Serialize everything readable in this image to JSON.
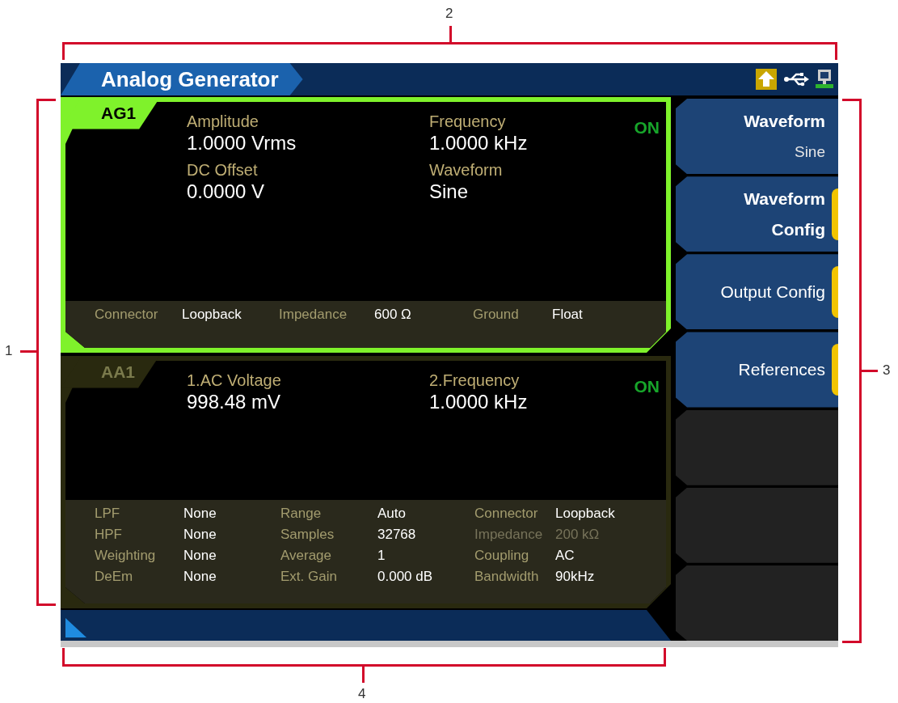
{
  "window": {
    "title": "Analog Generator"
  },
  "channels": [
    {
      "badge": "AG1",
      "selected": true,
      "state": "ON",
      "readings": [
        {
          "label": "Amplitude",
          "value": "1.0000 Vrms"
        },
        {
          "label": "Frequency",
          "value": "1.0000 kHz"
        },
        {
          "label": "DC Offset",
          "value": "0.0000 V"
        },
        {
          "label": "Waveform",
          "value": "Sine"
        }
      ],
      "settings": [
        {
          "label": "Connector",
          "value": "Loopback",
          "disabled": false
        },
        {
          "label": "Impedance",
          "value": "600 Ω",
          "disabled": false
        },
        {
          "label": "Ground",
          "value": "Float",
          "disabled": false
        }
      ]
    },
    {
      "badge": "AA1",
      "selected": false,
      "state": "ON",
      "readings": [
        {
          "label": "1.AC Voltage",
          "value": "998.48 mV"
        },
        {
          "label": "2.Frequency",
          "value": "1.0000 kHz"
        }
      ],
      "settings": [
        {
          "label": "LPF",
          "value": "None",
          "disabled": false
        },
        {
          "label": "Range",
          "value": "Auto",
          "disabled": false
        },
        {
          "label": "Connector",
          "value": "Loopback",
          "disabled": false
        },
        {
          "label": "HPF",
          "value": "None",
          "disabled": false
        },
        {
          "label": "Samples",
          "value": "32768",
          "disabled": false
        },
        {
          "label": "Impedance",
          "value": "200 kΩ",
          "disabled": true
        },
        {
          "label": "Weighting",
          "value": "None",
          "disabled": false
        },
        {
          "label": "Average",
          "value": "1",
          "disabled": false
        },
        {
          "label": "Coupling",
          "value": "AC",
          "disabled": false
        },
        {
          "label": "DeEm",
          "value": "None",
          "disabled": false
        },
        {
          "label": "Ext. Gain",
          "value": "0.000 dB",
          "disabled": false
        },
        {
          "label": "Bandwidth",
          "value": "90kHz",
          "disabled": false
        }
      ]
    }
  ],
  "softkeys": [
    {
      "kind": "value",
      "label": "Waveform",
      "value": "Sine",
      "submenu": false
    },
    {
      "kind": "label",
      "label": "Waveform\nConfig",
      "submenu": true
    },
    {
      "kind": "label",
      "label": "Output Config",
      "submenu": true
    },
    {
      "kind": "label",
      "label": "References",
      "submenu": true
    },
    {
      "kind": "blank"
    },
    {
      "kind": "blank"
    },
    {
      "kind": "blank"
    }
  ],
  "callouts": [
    {
      "number": "1",
      "kind": "left"
    },
    {
      "number": "2",
      "kind": "top"
    },
    {
      "number": "3",
      "kind": "right"
    },
    {
      "number": "4",
      "kind": "bottom"
    }
  ]
}
